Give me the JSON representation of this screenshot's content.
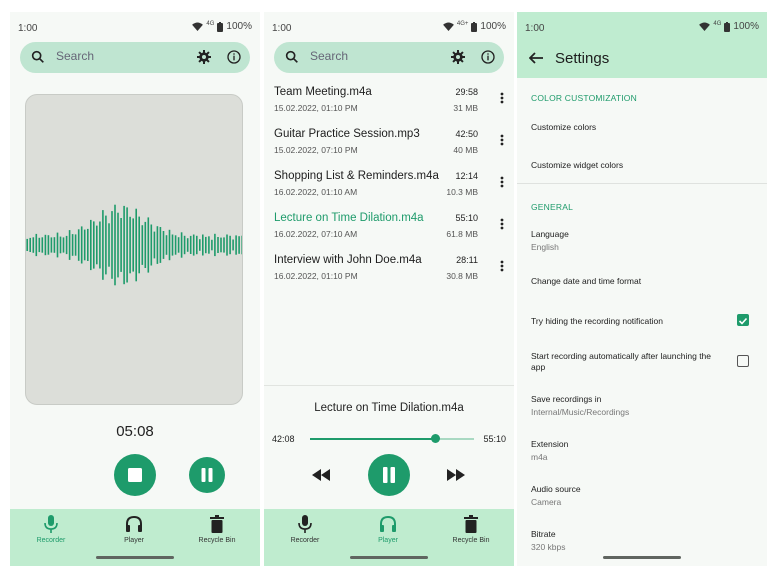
{
  "colors": {
    "accent": "#1e9b6b",
    "bar_bg": "#bfecd0",
    "search_bg": "#bfe5d1"
  },
  "status": {
    "time": "1:00",
    "network_1": "4G",
    "network_2": "4G+",
    "network_3": "4G",
    "battery": "100%"
  },
  "search": {
    "placeholder": "Search"
  },
  "recorder": {
    "timer": "05:08"
  },
  "nav": {
    "recorder": "Recorder",
    "player": "Player",
    "recycle_bin": "Recycle Bin"
  },
  "recordings": [
    {
      "name": "Team Meeting.m4a",
      "date": "15.02.2022, 01:10 PM",
      "duration": "29:58",
      "size": "31 MB"
    },
    {
      "name": "Guitar Practice Session.mp3",
      "date": "15.02.2022, 07:10 PM",
      "duration": "42:50",
      "size": "40 MB"
    },
    {
      "name": "Shopping List & Reminders.m4a",
      "date": "16.02.2022, 01:10 AM",
      "duration": "12:14",
      "size": "10.3 MB"
    },
    {
      "name": "Lecture on Time Dilation.m4a",
      "date": "16.02.2022, 07:10 AM",
      "duration": "55:10",
      "size": "61.8 MB"
    },
    {
      "name": "Interview with John Doe.m4a",
      "date": "16.02.2022, 01:10 PM",
      "duration": "28:11",
      "size": "30.8 MB"
    }
  ],
  "player": {
    "title": "Lecture on Time Dilation.m4a",
    "elapsed": "42:08",
    "total": "55:10",
    "progress": 0.76
  },
  "settings": {
    "title": "Settings",
    "section_color": "COLOR CUSTOMIZATION",
    "customize_colors": "Customize colors",
    "customize_widget_colors": "Customize widget colors",
    "section_general": "GENERAL",
    "language_label": "Language",
    "language_value": "English",
    "date_time_format": "Change date and time format",
    "hide_notification": "Try hiding the recording notification",
    "hide_notification_checked": true,
    "auto_start": "Start recording automatically after launching the app",
    "auto_start_checked": false,
    "save_in_label": "Save recordings in",
    "save_in_value": "Internal/Music/Recordings",
    "extension_label": "Extension",
    "extension_value": "m4a",
    "audio_source_label": "Audio source",
    "audio_source_value": "Camera",
    "bitrate_label": "Bitrate",
    "bitrate_value": "320 kbps"
  }
}
